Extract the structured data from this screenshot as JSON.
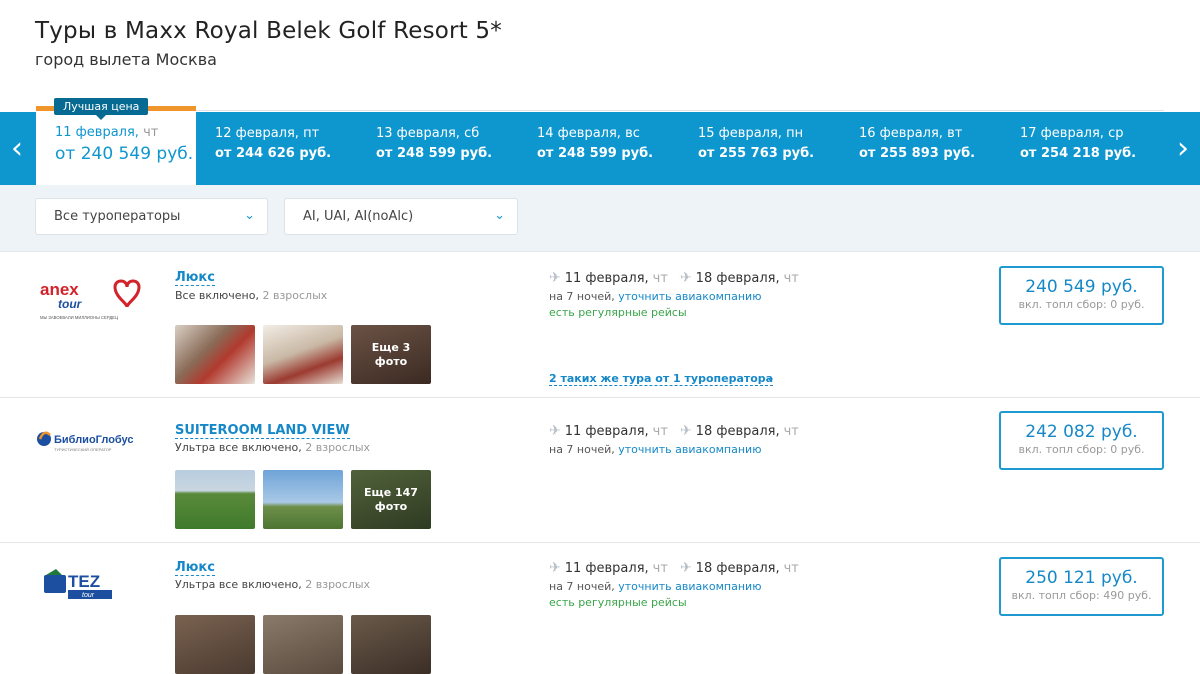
{
  "header": {
    "title": "Туры в Maxx Royal Belek Golf Resort 5*",
    "subtitle": "город вылета Москва"
  },
  "best_badge": "Лучшая цена",
  "dates": [
    {
      "date": "11 февраля,",
      "wd": " чт",
      "price": "от 240 549 руб."
    },
    {
      "date": "12 февраля,",
      "wd": " пт",
      "price": "от 244 626 руб."
    },
    {
      "date": "13 февраля,",
      "wd": " сб",
      "price": "от 248 599 руб."
    },
    {
      "date": "14 февраля,",
      "wd": " вс",
      "price": "от 248 599 руб."
    },
    {
      "date": "15 февраля,",
      "wd": " пн",
      "price": "от 255 763 руб."
    },
    {
      "date": "16 февраля,",
      "wd": " вт",
      "price": "от 255 893 руб."
    },
    {
      "date": "17 февраля,",
      "wd": " ср",
      "price": "от 254 218 руб."
    }
  ],
  "nav": {
    "prev": "‹",
    "next": "›"
  },
  "filters": {
    "operators": "Все туроператоры",
    "meal": "AI, UAI, AI(noAlc)",
    "chevron": "⌄"
  },
  "offers": [
    {
      "operator": "Anex Tour",
      "logo_text": "anex",
      "logo_text2": "tour",
      "logo_slogan": "МЫ ЗАВОЕВАЛИ МИЛЛИОНЫ СЕРДЕЦ",
      "room": "Люкс",
      "meal": "Все включено,",
      "guests": " 2 взрослых",
      "more_photos_1": "Еще 3",
      "more_photos_2": "фото",
      "out_date": "11 февраля,",
      "out_wd": "чт",
      "back_date": "18 февраля,",
      "back_wd": "чт",
      "nights": "на 7 ночей,",
      "airline": "уточнить авиакомпанию",
      "regular": "есть регулярные рейсы",
      "same_tours": "2 таких же тура от 1 туроператора",
      "price": "240 549 руб.",
      "fee": "вкл. топл сбор: 0 руб."
    },
    {
      "operator": "Библио Глобус",
      "logo_text": "БиблиоГлобус",
      "logo_slogan": "ТУРИСТИЧЕСКИЙ ОПЕРАТОР",
      "room": "SUITEROOM LAND VIEW",
      "meal": "Ультра все включено,",
      "guests": " 2 взрослых",
      "more_photos_1": "Еще 147",
      "more_photos_2": "фото",
      "out_date": "11 февраля,",
      "out_wd": "чт",
      "back_date": "18 февраля,",
      "back_wd": "чт",
      "nights": "на 7 ночей,",
      "airline": "уточнить авиакомпанию",
      "price": "242 082 руб.",
      "fee": "вкл. топл сбор: 0 руб."
    },
    {
      "operator": "TEZ Tour",
      "logo_text": "TEZ",
      "logo_text2": "tour",
      "room": "Люкс",
      "meal": "Ультра все включено,",
      "guests": " 2 взрослых",
      "out_date": "11 февраля,",
      "out_wd": "чт",
      "back_date": "18 февраля,",
      "back_wd": "чт",
      "nights": "на 7 ночей,",
      "airline": "уточнить авиакомпанию",
      "regular": "есть регулярные рейсы",
      "price": "250 121 руб.",
      "fee": "вкл. топл сбор: 490 руб."
    }
  ],
  "icons": {
    "plane": "✈"
  },
  "colors": {
    "accent": "#0e96cf",
    "best": "#f0952b",
    "link": "#1688c8",
    "green": "#3aa54a"
  }
}
